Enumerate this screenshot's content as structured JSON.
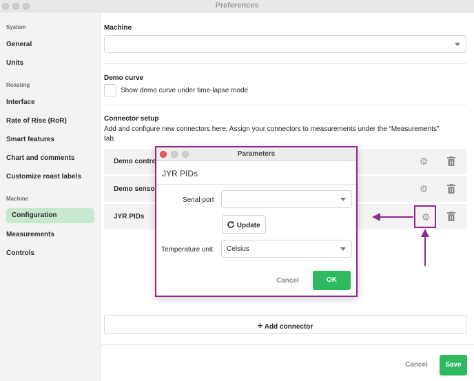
{
  "window": {
    "title": "Preferences"
  },
  "sidebar": {
    "sections": [
      {
        "label": "System",
        "items": [
          {
            "label": "General"
          },
          {
            "label": "Units"
          }
        ]
      },
      {
        "label": "Roasting",
        "items": [
          {
            "label": "Interface"
          },
          {
            "label": "Rate of Rise (RoR)"
          },
          {
            "label": "Smart features"
          },
          {
            "label": "Chart and comments"
          },
          {
            "label": "Customize roast labels"
          }
        ]
      },
      {
        "label": "Machine",
        "items": [
          {
            "label": "Configuration"
          },
          {
            "label": "Measurements"
          },
          {
            "label": "Controls"
          }
        ]
      }
    ],
    "active": "Configuration"
  },
  "main": {
    "machine_label": "Machine",
    "machine_value": "",
    "demo_curve_label": "Demo curve",
    "demo_curve_checkbox_label": "Show demo curve under time-lapse mode",
    "demo_curve_checked": false,
    "connector_setup_label": "Connector setup",
    "connector_setup_desc_line1": "Add and configure new connectors here. Assign your connectors to measurements under the “Measurements”",
    "connector_setup_desc_line2": "tab.",
    "connectors": [
      {
        "name": "Demo contro"
      },
      {
        "name": "Demo senso"
      },
      {
        "name": "JYR PIDs"
      }
    ],
    "add_connector_label": "Add connector",
    "cancel_label": "Cancel",
    "save_label": "Save"
  },
  "dialog": {
    "title": "Parameters",
    "heading": "JYR PIDs",
    "serial_port_label": "Serial port",
    "serial_port_value": "",
    "update_label": "Update",
    "temperature_unit_label": "Temperature unit",
    "temperature_unit_value": "Celsius",
    "cancel_label": "Cancel",
    "ok_label": "OK"
  },
  "colors": {
    "accent": "#2eb860",
    "active_nav": "#c7e7cf",
    "annotation": "#8a2a8a"
  },
  "icons": [
    "gear-icon",
    "trash-icon",
    "plus-icon",
    "refresh-icon",
    "arrow-left-icon",
    "arrow-up-icon"
  ]
}
